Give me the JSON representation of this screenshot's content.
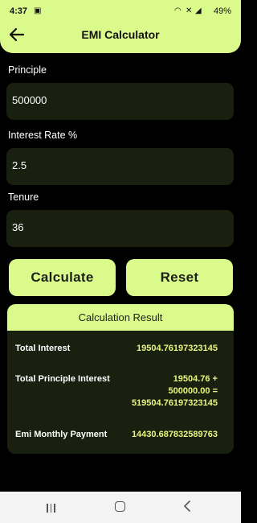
{
  "status": {
    "time": "4:37",
    "battery": "49%"
  },
  "header": {
    "title": "EMI Calculator"
  },
  "form": {
    "principle_label": "Principle",
    "principle_value": "500000",
    "rate_label": "Interest Rate %",
    "rate_value": "2.5",
    "tenure_label": "Tenure",
    "tenure_value": "36"
  },
  "buttons": {
    "calculate": "Calculate",
    "reset": "Reset"
  },
  "result": {
    "heading": "Calculation Result",
    "total_interest_label": "Total Interest",
    "total_interest_value": "19504.76197323145",
    "total_principle_label": "Total Principle Interest",
    "total_principle_line1": "19504.76 +",
    "total_principle_line2": "500000.00 =",
    "total_principle_line3": "519504.76197323145",
    "emi_label": "Emi Monthly Payment",
    "emi_value": "14430.687832589763"
  },
  "colors": {
    "accent": "#dbfa8c",
    "field_bg": "#1a2010",
    "value_text": "#e8f57e"
  }
}
